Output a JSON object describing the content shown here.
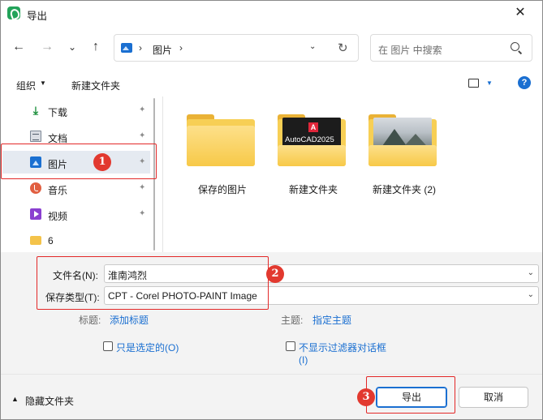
{
  "window": {
    "title": "导出",
    "close_glyph": "✕"
  },
  "nav": {
    "back": "←",
    "forward": "→",
    "recent": "⌄",
    "up": "↑",
    "address": {
      "separator": "›",
      "current": "图片",
      "dropdown": "⌄",
      "refresh": "↻"
    },
    "search_placeholder": "在 图片 中搜索"
  },
  "commandbar": {
    "organize": "组织",
    "new_folder": "新建文件夹",
    "help": "?"
  },
  "sidebar": {
    "items": [
      {
        "label": "下载",
        "icon": "download-icon",
        "pinned": true
      },
      {
        "label": "文档",
        "icon": "document-icon",
        "pinned": true
      },
      {
        "label": "图片",
        "icon": "pictures-icon",
        "pinned": true,
        "selected": true
      },
      {
        "label": "音乐",
        "icon": "music-icon",
        "pinned": true
      },
      {
        "label": "视频",
        "icon": "video-icon",
        "pinned": true
      },
      {
        "label": "6",
        "icon": "folder-icon",
        "pinned": false
      }
    ],
    "pin_glyph": "📌"
  },
  "folders": [
    {
      "label": "保存的图片",
      "thumbnail": "none"
    },
    {
      "label": "新建文件夹",
      "thumbnail": "autocad",
      "thumb_text": "AutoCAD2025",
      "thumb_logo": "A"
    },
    {
      "label": "新建文件夹 (2)",
      "thumbnail": "mountain"
    }
  ],
  "form": {
    "filename_label": "文件名(N):",
    "filename_value": "淮南鸿烈",
    "filetype_label": "保存类型(T):",
    "filetype_value": "CPT - Corel PHOTO-PAINT Image",
    "tags_label": "标题:",
    "tags_link": "添加标题",
    "subject_label": "主题:",
    "subject_link": "指定主题",
    "only_selected_label": "只是选定的(O)",
    "hide_filter_label_line1": "不显示过滤器对话框",
    "hide_filter_label_line2": "(I)"
  },
  "footer": {
    "hide_folders": "隐藏文件夹",
    "export_button": "导出",
    "cancel_button": "取消"
  },
  "annotations": {
    "badge1": "1",
    "badge2": "2",
    "badge3": "3"
  },
  "colors": {
    "accent": "#1a6fd1",
    "annotation_red": "#e32828",
    "folder_yellow": "#f7cf55"
  }
}
